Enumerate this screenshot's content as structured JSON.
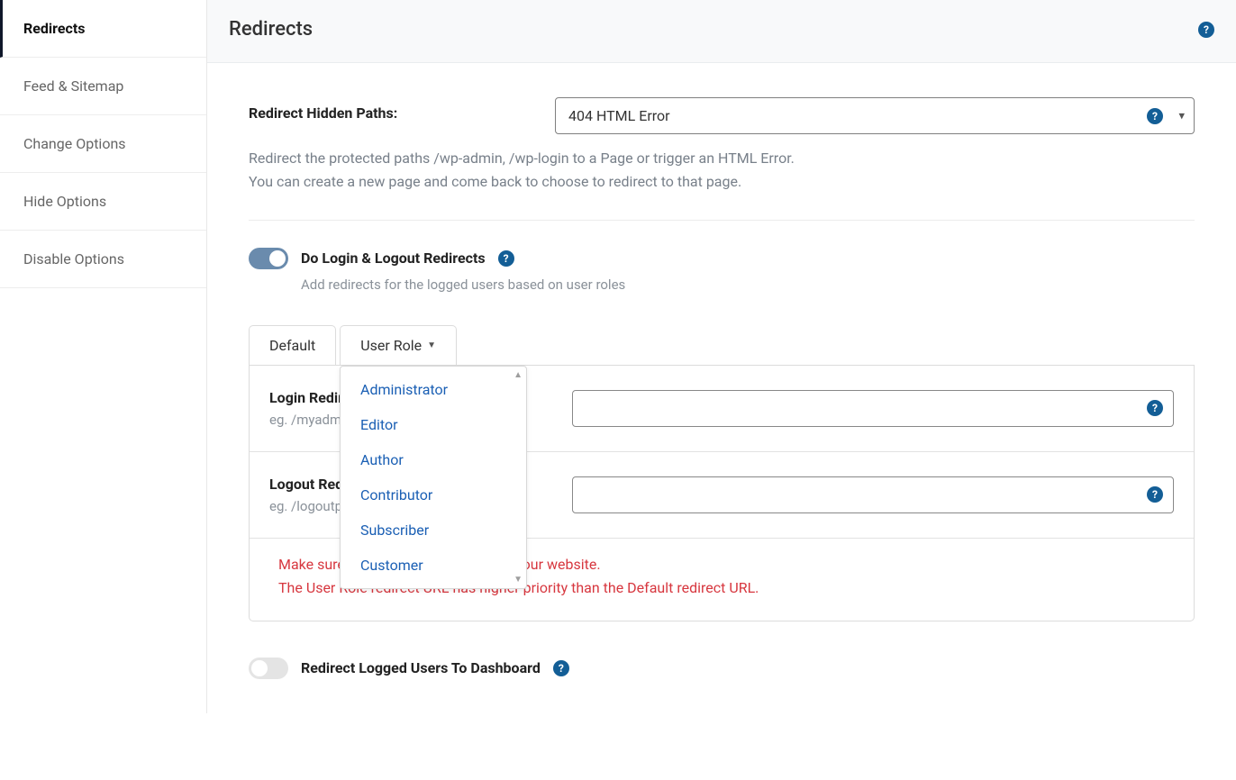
{
  "sidebar": {
    "items": [
      {
        "label": "Redirects",
        "active": true
      },
      {
        "label": "Feed & Sitemap"
      },
      {
        "label": "Change Options"
      },
      {
        "label": "Hide Options"
      },
      {
        "label": "Disable Options"
      }
    ]
  },
  "header": {
    "title": "Redirects"
  },
  "hidden_paths": {
    "label": "Redirect Hidden Paths:",
    "value": "404 HTML Error",
    "desc_line1": "Redirect the protected paths /wp-admin, /wp-login to a Page or trigger an HTML Error.",
    "desc_line2": "You can create a new page and come back to choose to redirect to that page."
  },
  "login_toggle": {
    "label": "Do Login & Logout Redirects",
    "desc": "Add redirects for the logged users based on user roles"
  },
  "tabs": {
    "default": "Default",
    "user_role": "User Role"
  },
  "rows": {
    "login": {
      "label": "Login Redirect URL:",
      "hint": "eg. /myadminpage/"
    },
    "logout": {
      "label": "Logout Redirect URL:",
      "hint": "eg. /logoutpage/"
    }
  },
  "dropdown": {
    "items": [
      "Administrator",
      "Editor",
      "Author",
      "Contributor",
      "Subscriber",
      "Customer"
    ]
  },
  "warn": {
    "line1": "Make sure the redirect URLs exist on your website.",
    "line2": "The User Role redirect URL has higher priority than the Default redirect URL."
  },
  "dashboard_toggle": {
    "label": "Redirect Logged Users To Dashboard"
  }
}
